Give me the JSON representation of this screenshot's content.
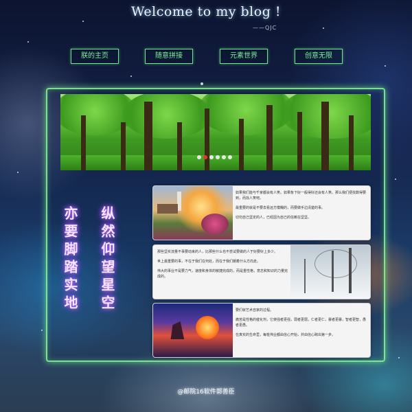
{
  "header": {
    "title": "Welcome to my blog !",
    "subtitle": "——QJC"
  },
  "nav": {
    "items": [
      {
        "label": "朕的主页"
      },
      {
        "label": "随意拼接"
      },
      {
        "label": "元素世界"
      },
      {
        "label": "创意无限"
      }
    ]
  },
  "banner": {
    "slides": 6,
    "active_slide": 2
  },
  "slogans": {
    "left": "亦要脚踏实地",
    "right": "纵然仰望星空"
  },
  "cards": [
    {
      "paragraphs": [
        "如果我们能与千家都会有人笑。如果象下好一般得好还会有人笑。那么我们便找数得要到，而找人笑吧。",
        "最重要的就是不要去看远方模糊的，而要做手边清楚的事。",
        "切勿自己坚定的人，已经因为自己的信赖在坚坚。"
      ]
    },
    {
      "paragraphs": [
        "那些坚实流量不事要动来的人，比那些什么也不尝试要做的人于好要好上多少。",
        "世上最重要的事，不在于我们在何处，而在于我们朝着什么方向走。",
        "伟大的事业不是要力气，速度和身体的敏捷完成的，而是重性格，意志和知识的力量完成的。"
      ]
    },
    {
      "paragraphs": [
        "要们就艺术自家的过程。",
        "痛苦是性格的催化剂，它使强者更强，弱者更弱，仁者更仁，暴者更暴，智者更智，愚者更愚。",
        "在真实的生命里，每桩伟业都由信心开始，并由信心跨出第一步。"
      ]
    }
  ],
  "footer": {
    "text": "@邮院16软件郭善臣"
  }
}
